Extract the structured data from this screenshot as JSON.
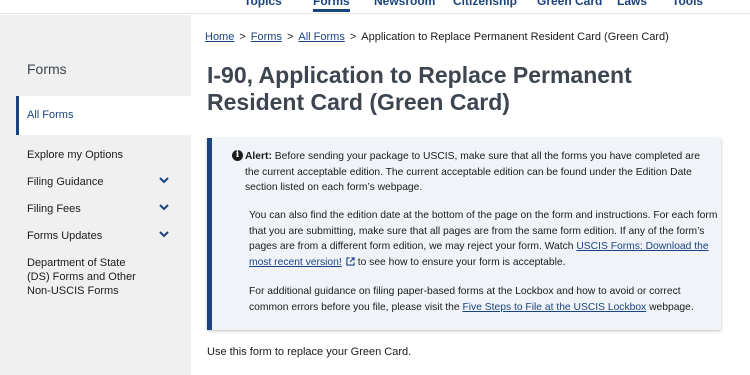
{
  "topnav": {
    "items": [
      "Topics",
      "Forms",
      "Newsroom",
      "Citizenship",
      "Green Card",
      "Laws",
      "Tools"
    ]
  },
  "sidebar": {
    "title": "Forms",
    "active_item": "All Forms",
    "items": [
      {
        "label": "Explore my Options",
        "expandable": false
      },
      {
        "label": "Filing Guidance",
        "expandable": true
      },
      {
        "label": "Filing Fees",
        "expandable": true
      },
      {
        "label": "Forms Updates",
        "expandable": true
      },
      {
        "label": "Department of State (DS) Forms and Other Non-USCIS Forms",
        "expandable": false
      }
    ]
  },
  "breadcrumb": {
    "home": "Home",
    "forms": "Forms",
    "all_forms": "All Forms",
    "current": "Application to Replace Permanent Resident Card (Green Card)"
  },
  "page": {
    "title": "I-90, Application to Replace Permanent Resident Card (Green Card)",
    "use_text": "Use this form to replace your Green Card."
  },
  "alert": {
    "label": "Alert:",
    "p1": "Before sending your package to USCIS, make sure that all the forms you have completed are the current acceptable edition. The current acceptable edition can be found under the Edition Date section listed on each form’s webpage.",
    "p2_before": "You can also find the edition date at the bottom of the page on the form and instructions. For each form that you are submitting, make sure that all pages are from the same form edition. If any of the form’s pages are from a different form edition, we may reject your form. Watch",
    "p2_link": "USCIS Forms: Download the most recent version!",
    "p2_after": "to see how to ensure your form is acceptable.",
    "p3_before": "For additional guidance on filing paper-based forms at the Lockbox and how to avoid or correct common errors before you file, please visit the",
    "p3_link": "Five Steps to File at the USCIS Lockbox",
    "p3_after": "webpage."
  },
  "colors": {
    "link": "#1a4480",
    "sidebar_bg": "#f0f0f0",
    "alert_bg": "#f0f3f8",
    "title": "#3d4551"
  }
}
